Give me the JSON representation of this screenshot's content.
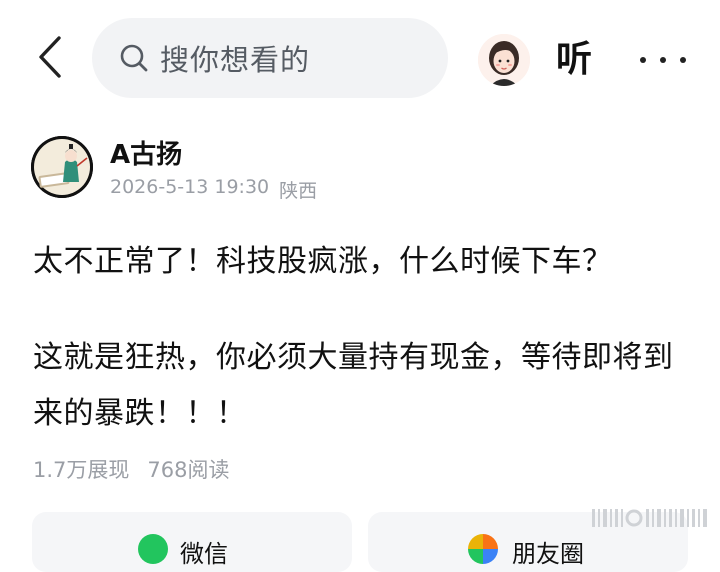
{
  "header": {
    "back_icon": "chevron-left-icon",
    "search": {
      "icon": "search-icon",
      "placeholder": "搜你想看的"
    },
    "avatar_icon": "user-avatar",
    "listen_label": "听",
    "more_icon": "more-horizontal-icon"
  },
  "post": {
    "author": {
      "name": "A古扬",
      "avatar": "author-avatar"
    },
    "date": "2026-5-13 19:30",
    "location": "陕西",
    "body": {
      "line1": "太不正常了！科技股疯涨，什么时候下车？",
      "para2": "这就是狂热，你必须大量持有现金，等待即将到来的暴跌！！！"
    },
    "stats": {
      "impressions": "1.7万展现",
      "reads": "768阅读"
    }
  },
  "share": {
    "wechat_label": "微信",
    "moments_label": "朋友圈"
  },
  "colors": {
    "search_bg": "#f2f3f5",
    "meta_text": "#9a9ea5",
    "wechat_green": "#22c55e"
  }
}
